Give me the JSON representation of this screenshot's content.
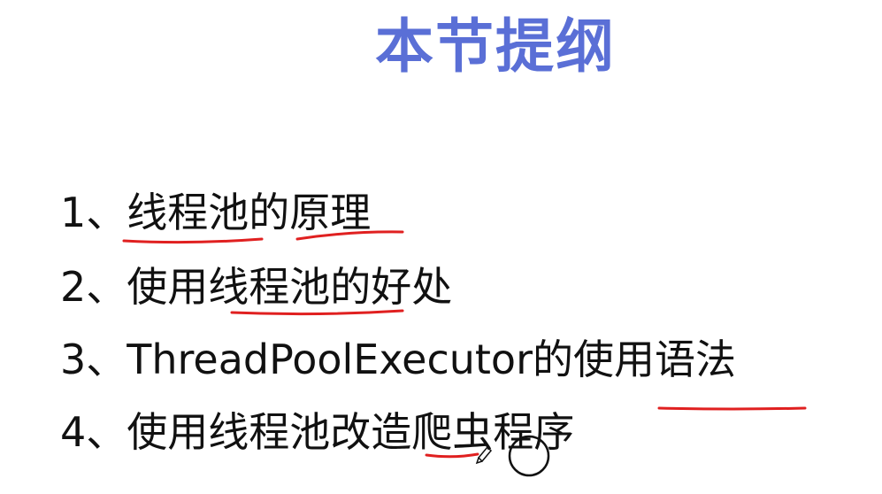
{
  "slide": {
    "title": "本节提纲",
    "items": [
      "1、线程池的原理",
      "2、使用线程池的好处",
      "3、ThreadPoolExecutor的使用语法",
      "4、使用线程池改造爬虫程序"
    ]
  },
  "colors": {
    "title": "#5a6fd6",
    "text": "#111111",
    "annotation": "#e02020",
    "background": "#ffffff"
  }
}
